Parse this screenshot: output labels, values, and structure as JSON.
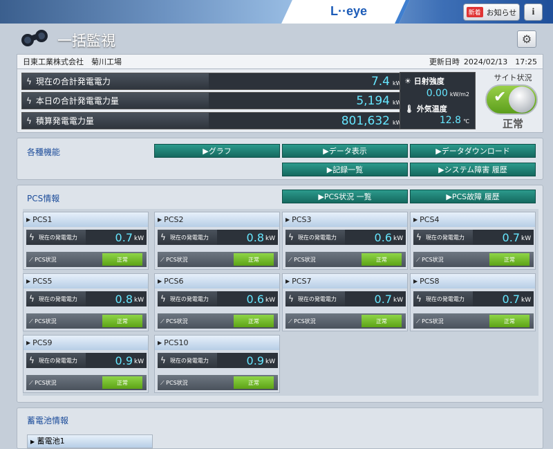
{
  "header": {
    "logo": "L··eye",
    "notice_badge": "新着",
    "notice_label": "お知らせ",
    "info_label": "i"
  },
  "page_title": "一括監視",
  "site": {
    "name": "日東工業株式会社　菊川工場",
    "updated_label": "更新日時",
    "updated_value": "2024/02/13　17:25"
  },
  "summary": {
    "current_power": {
      "label": "現在の合計発電電力",
      "value": "7.4",
      "unit": "kW"
    },
    "today_energy": {
      "label": "本日の合計発電電力量",
      "value": "5,194",
      "unit": "kWh"
    },
    "total_energy": {
      "label": "積算発電電力量",
      "value": "801,632",
      "unit": "kWh"
    }
  },
  "weather": {
    "irradiance_label": "日射強度",
    "irradiance_value": "0.00",
    "irradiance_unit": "kW/m2",
    "temp_label": "外気温度",
    "temp_value": "12.8",
    "temp_unit": "℃"
  },
  "site_status": {
    "title": "サイト状況",
    "value": "正常",
    "on": true
  },
  "functions": {
    "title": "各種機能",
    "buttons": [
      "▶グラフ",
      "▶データ表示",
      "▶データダウンロード",
      "▶記録一覧",
      "▶システム障害 履歴"
    ]
  },
  "pcs": {
    "title": "PCS情報",
    "status_list_button": "▶PCS状況 一覧",
    "fault_history_button": "▶PCS故障 履歴",
    "power_label": "現在の発電電力",
    "status_label": "PCS状況",
    "unit": "kW",
    "units": [
      {
        "name": "PCS1",
        "power": "0.7",
        "status": "正常"
      },
      {
        "name": "PCS2",
        "power": "0.8",
        "status": "正常"
      },
      {
        "name": "PCS3",
        "power": "0.6",
        "status": "正常"
      },
      {
        "name": "PCS4",
        "power": "0.7",
        "status": "正常"
      },
      {
        "name": "PCS5",
        "power": "0.8",
        "status": "正常"
      },
      {
        "name": "PCS6",
        "power": "0.6",
        "status": "正常"
      },
      {
        "name": "PCS7",
        "power": "0.7",
        "status": "正常"
      },
      {
        "name": "PCS8",
        "power": "0.7",
        "status": "正常"
      },
      {
        "name": "PCS9",
        "power": "0.9",
        "status": "正常"
      },
      {
        "name": "PCS10",
        "power": "0.9",
        "status": "正常"
      }
    ]
  },
  "battery": {
    "title": "蓄電池情報",
    "card_label": "蓄電池1"
  },
  "colors": {
    "value_cyan": "#66e7ff",
    "teal_button": "#1a7d70",
    "status_green": "#73bd2d",
    "section_blue": "#1c4c9a"
  }
}
